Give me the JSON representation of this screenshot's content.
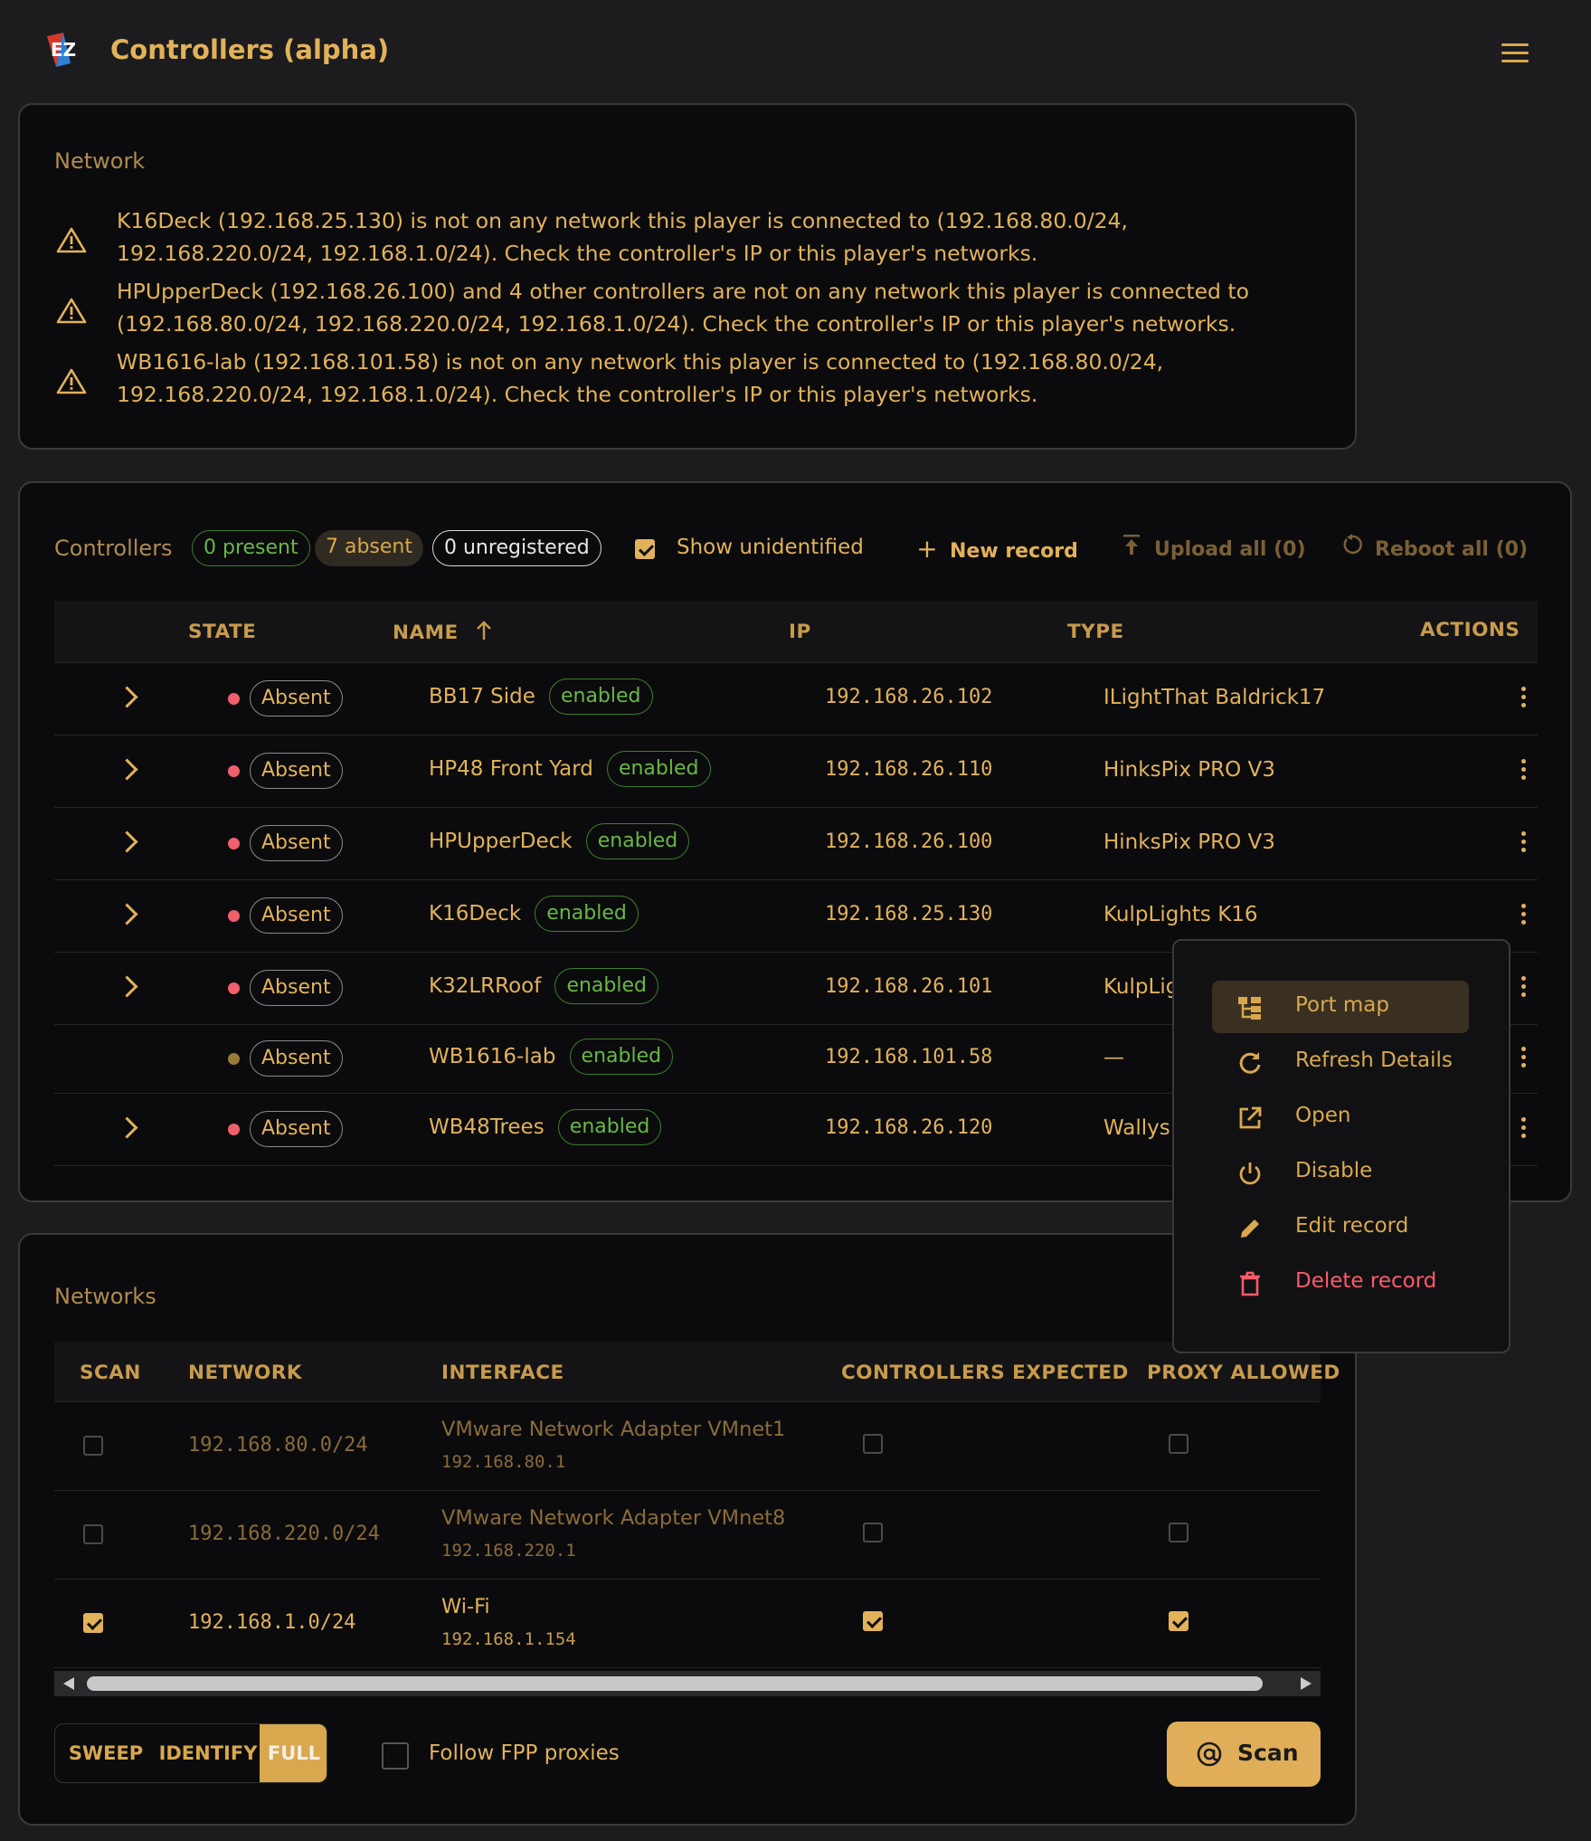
{
  "header": {
    "title": "Controllers (alpha)",
    "logo_text": "EZ"
  },
  "network": {
    "label": "Network",
    "warnings": [
      "K16Deck (192.168.25.130) is not on any network this player is connected to (192.168.80.0/24, 192.168.220.0/24, 192.168.1.0/24). Check the controller's IP or this player's networks.",
      "HPUpperDeck (192.168.26.100) and 4 other controllers are not on any network this player is connected to (192.168.80.0/24, 192.168.220.0/24, 192.168.1.0/24). Check the controller's IP or this player's networks.",
      "WB1616-lab (192.168.101.58) is not on any network this player is connected to (192.168.80.0/24, 192.168.220.0/24, 192.168.1.0/24). Check the controller's IP or this player's networks."
    ]
  },
  "controllers": {
    "label": "Controllers",
    "present": "0 present",
    "absent": "7 absent",
    "unregistered": "0 unregistered",
    "show_unidentified": "Show unidentified",
    "show_unidentified_checked": true,
    "new_record": "New record",
    "upload_all": "Upload all (0)",
    "reboot_all": "Reboot all (0)",
    "columns": {
      "state": "STATE",
      "name": "NAME",
      "ip": "IP",
      "type": "TYPE",
      "actions": "ACTIONS"
    },
    "rows": [
      {
        "state": "Absent",
        "name": "BB17 Side",
        "status": "enabled",
        "ip": "192.168.26.102",
        "type": "ILightThat Baldrick17",
        "expandable": true,
        "dot": "#f0606a"
      },
      {
        "state": "Absent",
        "name": "HP48 Front Yard",
        "status": "enabled",
        "ip": "192.168.26.110",
        "type": "HinksPix PRO V3",
        "expandable": true,
        "dot": "#f0606a"
      },
      {
        "state": "Absent",
        "name": "HPUpperDeck",
        "status": "enabled",
        "ip": "192.168.26.100",
        "type": "HinksPix PRO V3",
        "expandable": true,
        "dot": "#f0606a"
      },
      {
        "state": "Absent",
        "name": "K16Deck",
        "status": "enabled",
        "ip": "192.168.25.130",
        "type": "KulpLights K16",
        "expandable": true,
        "dot": "#f0606a"
      },
      {
        "state": "Absent",
        "name": "K32LRRoof",
        "status": "enabled",
        "ip": "192.168.26.101",
        "type": "KulpLights",
        "expandable": true,
        "dot": "#f0606a"
      },
      {
        "state": "Absent",
        "name": "WB1616-lab",
        "status": "enabled",
        "ip": "192.168.101.58",
        "type": "—",
        "expandable": false,
        "dot": "#9a7a3a"
      },
      {
        "state": "Absent",
        "name": "WB48Trees",
        "status": "enabled",
        "ip": "192.168.26.120",
        "type": "Wallys Ligh",
        "expandable": true,
        "dot": "#f0606a"
      }
    ]
  },
  "context_menu": {
    "items": [
      {
        "label": "Port map",
        "icon": "port-map-icon"
      },
      {
        "label": "Refresh Details",
        "icon": "refresh-icon"
      },
      {
        "label": "Open",
        "icon": "open-external-icon"
      },
      {
        "label": "Disable",
        "icon": "power-icon"
      },
      {
        "label": "Edit record",
        "icon": "pencil-icon"
      },
      {
        "label": "Delete record",
        "icon": "trash-icon"
      }
    ],
    "danger_color": "#ff5a6a"
  },
  "networks": {
    "label": "Networks",
    "columns": {
      "scan": "SCAN",
      "network": "NETWORK",
      "interface": "INTERFACE",
      "expected": "CONTROLLERS EXPECTED",
      "proxy": "PROXY ALLOWED"
    },
    "rows": [
      {
        "network": "192.168.80.0/24",
        "interface": "VMware Network Adapter VMnet1",
        "iface_ip": "192.168.80.1",
        "scan": false,
        "expected": false,
        "proxy": false
      },
      {
        "network": "192.168.220.0/24",
        "interface": "VMware Network Adapter VMnet8",
        "iface_ip": "192.168.220.1",
        "scan": false,
        "expected": false,
        "proxy": false
      },
      {
        "network": "192.168.1.0/24",
        "interface": "Wi-Fi",
        "iface_ip": "192.168.1.154",
        "scan": true,
        "expected": true,
        "proxy": true
      }
    ],
    "modes": [
      "SWEEP",
      "IDENTIFY",
      "FULL"
    ],
    "active_mode": "FULL",
    "follow_proxies": "Follow FPP proxies",
    "follow_proxies_checked": false,
    "scan_button": "Scan"
  },
  "colors": {
    "accent": "#e2b25a",
    "bg": "#1c1c1e",
    "panel": "#0b0b0d",
    "success": "#67b845",
    "absent_dot": "#f0606a"
  }
}
